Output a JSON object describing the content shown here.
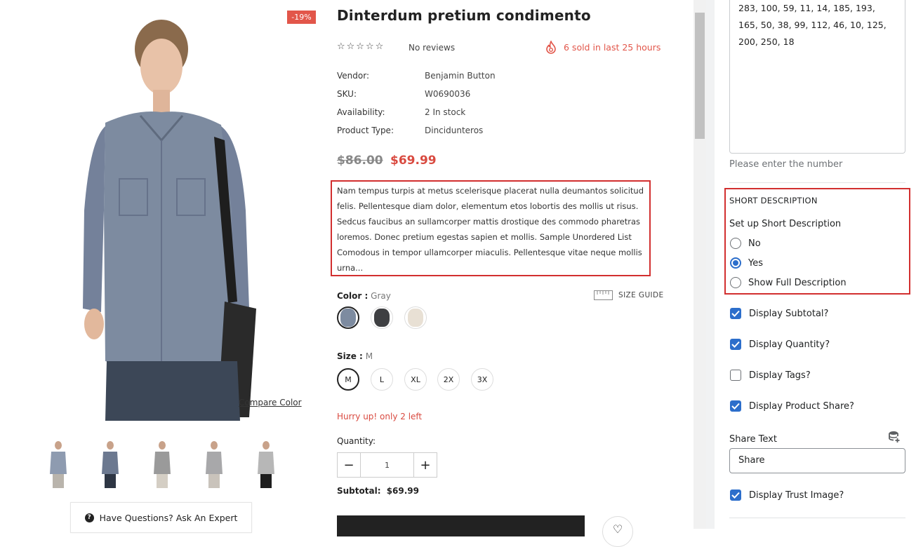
{
  "gallery": {
    "discount_badge": "-19%",
    "compare_color": "Compare Color",
    "thumbnails": [
      "thumb-1",
      "thumb-2",
      "thumb-3",
      "thumb-4",
      "thumb-5"
    ],
    "ask_expert": "Have Questions? Ask An Expert"
  },
  "product": {
    "title": "Dinterdum pretium condimento",
    "stars": "☆☆☆☆☆",
    "reviews": "No reviews",
    "sold": "6 sold in last 25 hours",
    "meta": [
      {
        "label": "Vendor:",
        "value": "Benjamin Button"
      },
      {
        "label": "SKU:",
        "value": "W0690036"
      },
      {
        "label": "Availability:",
        "value": "2 In stock"
      },
      {
        "label": "Product Type:",
        "value": "Dincidunteros"
      }
    ],
    "price_old": "$86.00",
    "price_new": "$69.99",
    "description": "Nam tempus turpis at metus scelerisque placerat nulla deumantos solicitud felis. Pellentesque diam dolor, elementum etos lobortis des mollis ut risus. Sedcus faucibus an sullamcorper mattis drostique des commodo pharetras loremos. Donec pretium egestas sapien et mollis. Sample Unordered List Comodous in tempor ullamcorper miaculis. Pellentesque vitae neque mollis urna...",
    "color_label": "Color :",
    "color_value": "Gray",
    "size_guide": "SIZE GUIDE",
    "swatch_colors": [
      "#7d8ba0",
      "#3e3f42",
      "#e8e0d4"
    ],
    "size_label": "Size :",
    "size_value": "M",
    "sizes": [
      "M",
      "L",
      "XL",
      "2X",
      "3X"
    ],
    "hurry": "Hurry up! only 2 left",
    "quantity_label": "Quantity:",
    "quantity_value": "1",
    "subtotal_label": "Subtotal:",
    "subtotal_value": "$69.99"
  },
  "panel": {
    "number_list": "283, 100, 59, 11, 14, 185, 193, 165, 50, 38, 99, 112, 46, 10, 125, 200, 250, 18",
    "number_hint": "Please enter the number",
    "short_desc_title": "SHORT DESCRIPTION",
    "short_desc_label": "Set up Short Description",
    "short_desc_options": [
      {
        "label": "No",
        "selected": false
      },
      {
        "label": "Yes",
        "selected": true
      },
      {
        "label": "Show Full Description",
        "selected": false
      }
    ],
    "checkboxes": [
      {
        "label": "Display Subtotal?",
        "checked": true
      },
      {
        "label": "Display Quantity?",
        "checked": true
      },
      {
        "label": "Display Tags?",
        "checked": false
      },
      {
        "label": "Display Product Share?",
        "checked": true
      }
    ],
    "share_text_label": "Share Text",
    "share_text_value": "Share",
    "trust_image_label": "Display Trust Image?",
    "trust_image_checked": true,
    "accent_color": "#2c6ecb"
  }
}
